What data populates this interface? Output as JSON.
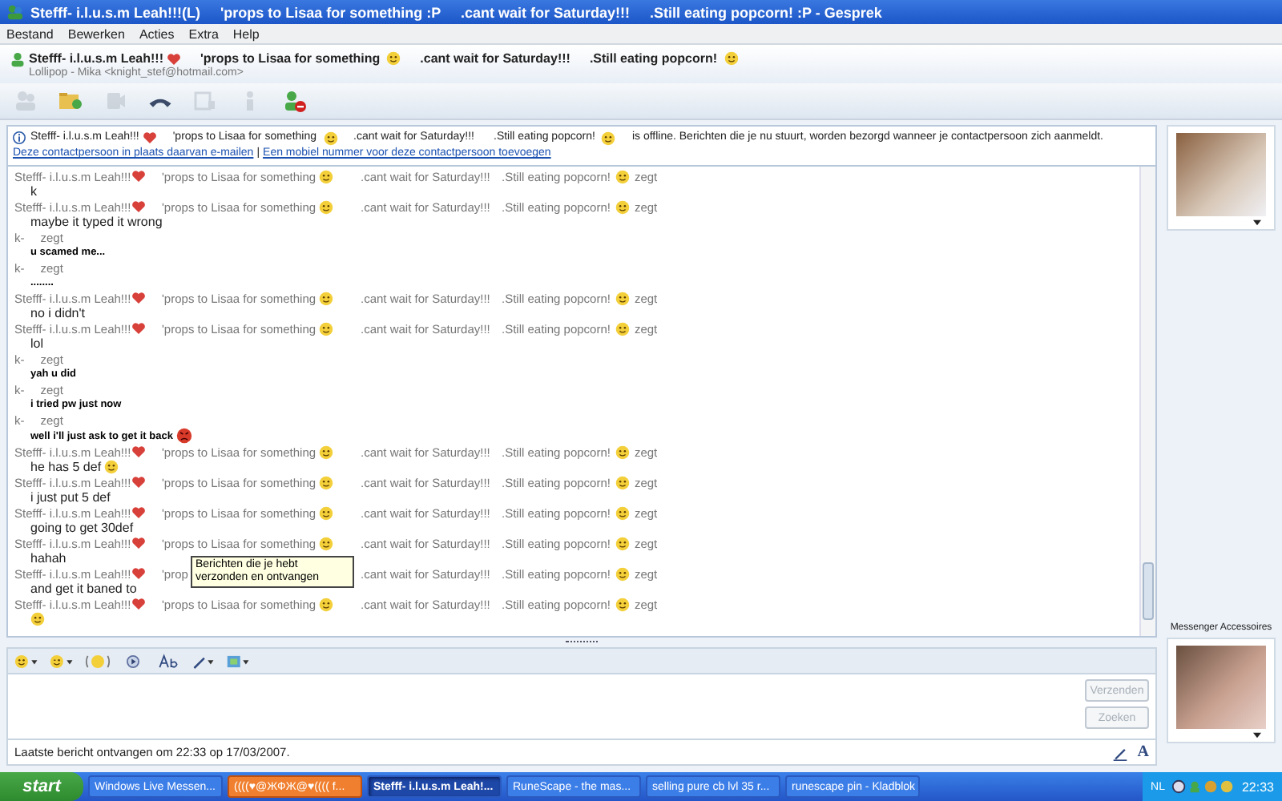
{
  "window": {
    "title": "Stefff- i.l.u.s.m Leah!!!(L)     'props to Lisaa for something :P     .cant wait for Saturday!!!     .Still eating popcorn! :P - Gesprek"
  },
  "menu": [
    "Bestand",
    "Bewerken",
    "Acties",
    "Extra",
    "Help"
  ],
  "contact": {
    "name": "Stefff- i.l.u.s.m Leah!!!",
    "status": "'props to Lisaa for something",
    "wait": ".cant wait for Saturday!!!",
    "popcorn": ".Still eating popcorn!",
    "email": "Lollipop - Mika <knight_stef@hotmail.com>"
  },
  "toolbar": [
    {
      "kind": "people",
      "disabled": true
    },
    {
      "kind": "folder",
      "disabled": false
    },
    {
      "kind": "camera",
      "disabled": true
    },
    {
      "kind": "phone",
      "disabled": false
    },
    {
      "kind": "window",
      "disabled": true
    },
    {
      "kind": "figure",
      "disabled": true
    },
    {
      "kind": "block",
      "disabled": false
    }
  ],
  "info_bar": {
    "name": "Stefff- i.l.u.s.m Leah!!!",
    "status": "'props to Lisaa for something",
    "wait": ".cant wait for Saturday!!!",
    "popcorn": ".Still eating popcorn!",
    "message": "is offline. Berichten die je nu stuurt, worden bezorgd wanneer je contactpersoon zich aanmeldt.",
    "links": [
      "Deze contactpersoon in plaats daarvan e-mailen",
      "Een mobiel nummer voor deze contactpersoon toevoegen"
    ],
    "separator": "|"
  },
  "messages": [
    {
      "kind": "contact",
      "header": {
        "name": "Stefff- i.l.u.s.m Leah!!!",
        "status": "'props to Lisaa for something",
        "status_emoticon": {
          "kind": "smile"
        },
        "wait": ".cant wait for Saturday!!!",
        "popcorn": ".Still eating popcorn!",
        "says": "zegt"
      },
      "text": "k"
    },
    {
      "kind": "contact",
      "header": {
        "name": "Stefff- i.l.u.s.m Leah!!!",
        "status": "'props to Lisaa for something",
        "status_emoticon": {
          "kind": "smile"
        },
        "wait": ".cant wait for Saturday!!!",
        "popcorn": ".Still eating popcorn!",
        "says": "zegt"
      },
      "text": "maybe it typed it wrong"
    },
    {
      "kind": "me",
      "header": {
        "name": "k-",
        "says": "zegt"
      },
      "text": "u scamed me..."
    },
    {
      "kind": "me",
      "header": {
        "name": "k-",
        "says": "zegt"
      },
      "text": "........"
    },
    {
      "kind": "contact",
      "header": {
        "name": "Stefff- i.l.u.s.m Leah!!!",
        "status": "'props to Lisaa for something",
        "status_emoticon": {
          "kind": "smile"
        },
        "wait": ".cant wait for Saturday!!!",
        "popcorn": ".Still eating popcorn!",
        "says": "zegt"
      },
      "text": "no i didn't"
    },
    {
      "kind": "contact",
      "header": {
        "name": "Stefff- i.l.u.s.m Leah!!!",
        "status": "'props to Lisaa for something",
        "status_emoticon": {
          "kind": "smile"
        },
        "wait": ".cant wait for Saturday!!!",
        "popcorn": ".Still eating popcorn!",
        "says": "zegt"
      },
      "text": "lol"
    },
    {
      "kind": "me",
      "header": {
        "name": "k-",
        "says": "zegt"
      },
      "text": "yah u did"
    },
    {
      "kind": "me",
      "header": {
        "name": "k-",
        "says": "zegt"
      },
      "text": "i tried pw just now"
    },
    {
      "kind": "me",
      "header": {
        "name": "k-",
        "says": "zegt"
      },
      "text": "well i'll just ask to get it back",
      "emoticon": {
        "kind": "angry"
      }
    },
    {
      "kind": "contact",
      "header": {
        "name": "Stefff- i.l.u.s.m Leah!!!",
        "status": "'props to Lisaa for something",
        "status_emoticon": {
          "kind": "smile"
        },
        "wait": ".cant wait for Saturday!!!",
        "popcorn": ".Still eating popcorn!",
        "says": "zegt"
      },
      "text": "he has 5 def",
      "emoticon": {
        "kind": "smile"
      }
    },
    {
      "kind": "contact",
      "header": {
        "name": "Stefff- i.l.u.s.m Leah!!!",
        "status": "'props to Lisaa for something",
        "status_emoticon": {
          "kind": "smile"
        },
        "wait": ".cant wait for Saturday!!!",
        "popcorn": ".Still eating popcorn!",
        "says": "zegt"
      },
      "text": "i just put 5 def"
    },
    {
      "kind": "contact",
      "header": {
        "name": "Stefff- i.l.u.s.m Leah!!!",
        "status": "'props to Lisaa for something",
        "status_emoticon": {
          "kind": "smile"
        },
        "wait": ".cant wait for Saturday!!!",
        "popcorn": ".Still eating popcorn!",
        "says": "zegt"
      },
      "text": "going to get 30def"
    },
    {
      "kind": "contact",
      "header": {
        "name": "Stefff- i.l.u.s.m Leah!!!",
        "status": "'props to Lisaa for something",
        "status_emoticon": {
          "kind": "smile"
        },
        "wait": ".cant wait for Saturday!!!",
        "popcorn": ".Still eating popcorn!",
        "says": "zegt"
      },
      "text": "hahah",
      "tooltip": "Berichten die je hebt verzonden en ontvangen"
    },
    {
      "kind": "contact",
      "header": {
        "name": "Stefff- i.l.u.s.m Leah!!!",
        "status": "'prop",
        "wait": ".cant wait for Saturday!!!",
        "popcorn": ".Still eating popcorn!",
        "says": "zegt"
      },
      "text": "and get it baned to"
    },
    {
      "kind": "contact",
      "header": {
        "name": "Stefff- i.l.u.s.m Leah!!!",
        "status": "'props to Lisaa for something",
        "status_emoticon": {
          "kind": "smile"
        },
        "wait": ".cant wait for Saturday!!!",
        "popcorn": ".Still eating popcorn!",
        "says": "zegt"
      },
      "emoticon": {
        "kind": "smile"
      }
    }
  ],
  "format_toolbar": [
    {
      "kind": "emoticon"
    },
    {
      "kind": "wink"
    },
    {
      "kind": "nudge"
    },
    {
      "kind": "voice"
    },
    {
      "kind": "font"
    },
    {
      "kind": "ink"
    },
    {
      "kind": "background"
    }
  ],
  "buttons": [
    {
      "label": "Verzenden",
      "disabled": true
    },
    {
      "label": "Zoeken",
      "disabled": true
    }
  ],
  "status_bar": {
    "text": "Laatste bericht ontvangen om 22:33 op 17/03/2007.",
    "font_button": "A"
  },
  "accessories": {
    "label": "Messenger Accessoires"
  },
  "taskbar": {
    "start": "start",
    "tasks": [
      {
        "label": "Windows Live Messen...",
        "selected": false,
        "flashing": false
      },
      {
        "label": "((((♥@ЖФЖ@♥((((  f...",
        "selected": false,
        "flashing": true
      },
      {
        "label": "Stefff- i.l.u.s.m Leah!...",
        "selected": true,
        "flashing": false
      },
      {
        "label": "RuneScape - the mas...",
        "selected": false,
        "flashing": false
      },
      {
        "label": "selling pure cb lvl 35 r...",
        "selected": false,
        "flashing": false
      },
      {
        "label": "runescape pin - Kladblok",
        "selected": false,
        "flashing": false
      }
    ],
    "language": "NL",
    "clock": "22:33"
  }
}
